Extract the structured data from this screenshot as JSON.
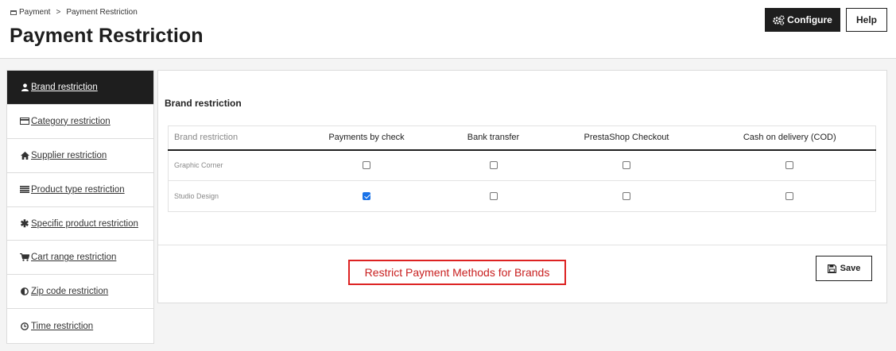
{
  "breadcrumb": {
    "parent": "Payment",
    "separator": ">",
    "current": "Payment Restriction"
  },
  "page_title": "Payment Restriction",
  "toolbar": {
    "configure_label": "Configure",
    "help_label": "Help"
  },
  "sidebar": {
    "items": [
      {
        "label": "Brand restriction",
        "icon": "user-icon",
        "active": true
      },
      {
        "label": "Category restriction",
        "icon": "card-icon",
        "active": false
      },
      {
        "label": "Supplier restriction",
        "icon": "home-icon",
        "active": false
      },
      {
        "label": "Product type restriction",
        "icon": "list-icon",
        "active": false
      },
      {
        "label": "Specific product restriction",
        "icon": "asterisk-icon",
        "active": false
      },
      {
        "label": "Cart range restriction",
        "icon": "cart-icon",
        "active": false
      },
      {
        "label": "Zip code restriction",
        "icon": "half-circle-icon",
        "active": false
      },
      {
        "label": "Time restriction",
        "icon": "clock-icon",
        "active": false
      }
    ]
  },
  "panel": {
    "title": "Brand restriction",
    "columns": [
      "Brand restriction",
      "Payments by check",
      "Bank transfer",
      "PrestaShop Checkout",
      "Cash on delivery (COD)"
    ],
    "rows": [
      {
        "name": "Graphic Corner",
        "checks": [
          false,
          false,
          false,
          false
        ]
      },
      {
        "name": "Studio Design",
        "checks": [
          true,
          false,
          false,
          false
        ]
      }
    ],
    "annotation": "Restrict Payment Methods for Brands",
    "save_label": "Save"
  },
  "colors": {
    "primary_dark": "#1e1e1e",
    "check_blue": "#1a73e8",
    "annotation_red": "#d22222"
  }
}
